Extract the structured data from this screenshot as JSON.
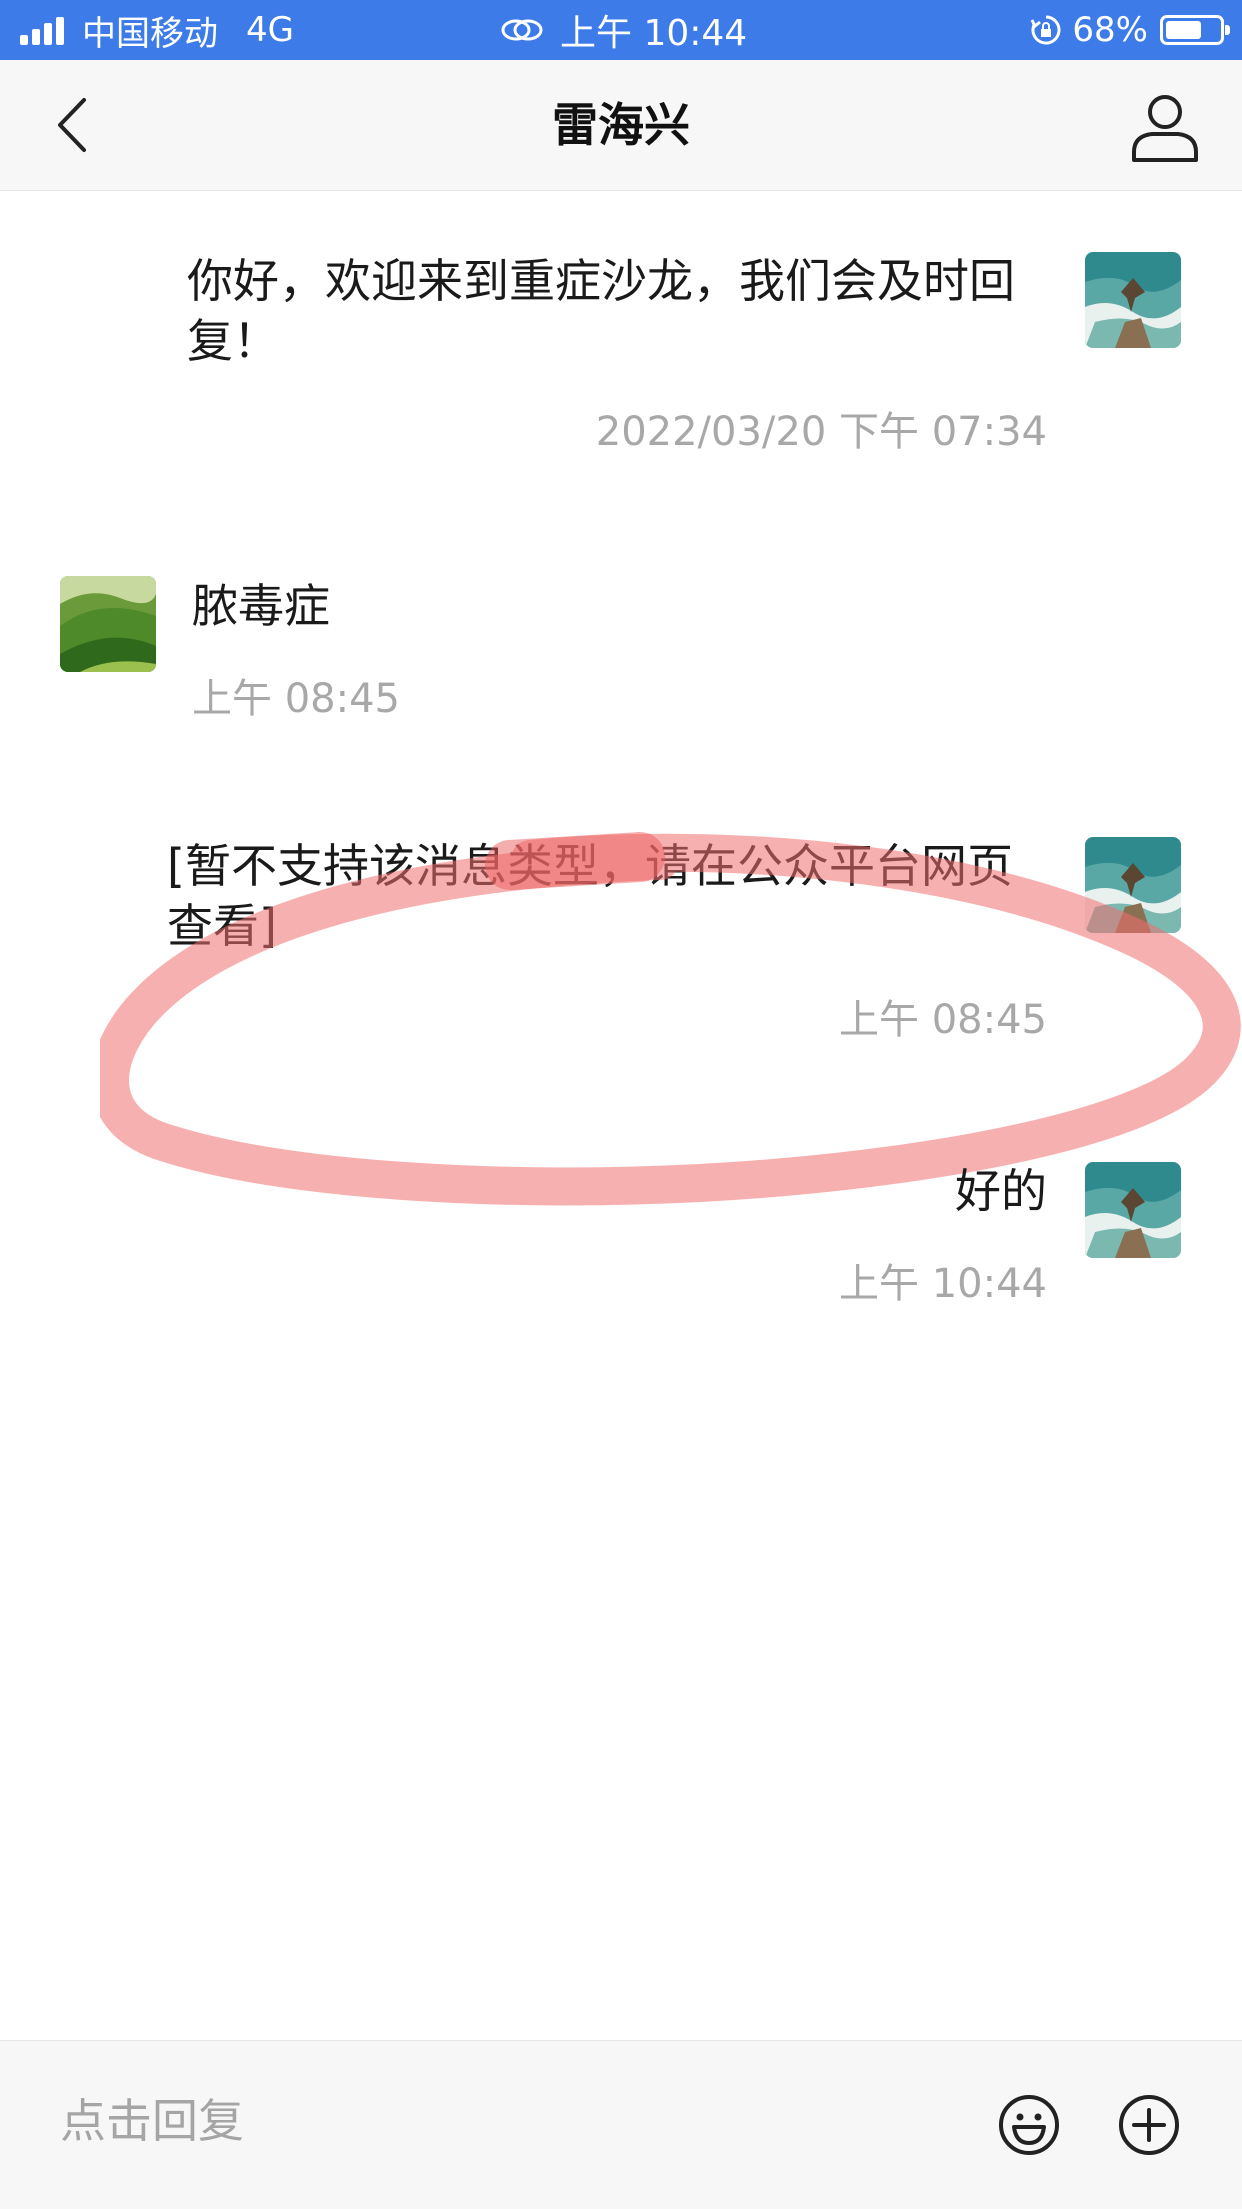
{
  "status_bar": {
    "carrier": "中国移动",
    "network": "4G",
    "time": "上午 10:44",
    "battery_percent": "68%",
    "battery_level": 0.68,
    "background_color": "#3d7be8",
    "icons": [
      "signal-icon",
      "link-icon",
      "lock-rotation-icon",
      "battery-icon"
    ]
  },
  "nav": {
    "title": "雷海兴",
    "back_icon": "chevron-left-icon",
    "profile_icon": "person-icon"
  },
  "messages": [
    {
      "side": "right",
      "text_line1": "你好，欢迎来到重症沙龙，我们会及时回",
      "text_line2": "复！",
      "time": "2022/03/20 下午 07:34",
      "avatar": "eagle-avatar"
    },
    {
      "side": "left",
      "text": "脓毒症",
      "time": "上午 08:45",
      "avatar": "green-hills-avatar"
    },
    {
      "side": "right",
      "text_line1": "[暂不支持该消息类型，请在公众平台网页",
      "text_line2": "查看]",
      "time": "上午 08:45",
      "avatar": "eagle-avatar",
      "annotation": "red-hand-drawn-circle"
    },
    {
      "side": "right",
      "text": "好的",
      "time": "上午 10:44",
      "avatar": "eagle-avatar"
    }
  ],
  "reply_bar": {
    "placeholder": "点击回复",
    "emoji_icon": "smiley-icon",
    "add_icon": "plus-circle-icon"
  },
  "colors": {
    "accent": "#3d7be8",
    "timestamp": "#a8a8a8",
    "annotation_red": "#f07070"
  }
}
